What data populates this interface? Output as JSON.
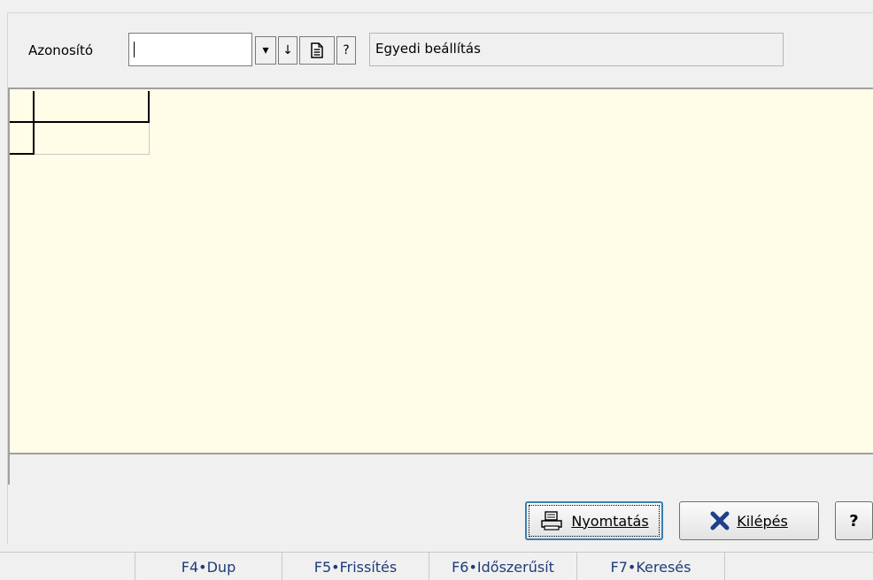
{
  "filter": {
    "label": "Azonosító",
    "value": "",
    "buttons": {
      "dropdown": "▾",
      "down": "↓",
      "doc": "🗎",
      "help": "?"
    },
    "description": "Egyedi beállítás"
  },
  "actions": {
    "print_label": "Nyomtatás",
    "exit_label": "Kilépés",
    "help_label": "?"
  },
  "function_keys": [
    {
      "label": "F4•Dup"
    },
    {
      "label": "F5•Frissítés"
    },
    {
      "label": "F6•Időszerűsít"
    },
    {
      "label": "F7•Keresés"
    }
  ],
  "colors": {
    "grid_background": "#fffde7",
    "exit_icon": "#1f3f8a",
    "function_key_text": "#1e3c78"
  }
}
